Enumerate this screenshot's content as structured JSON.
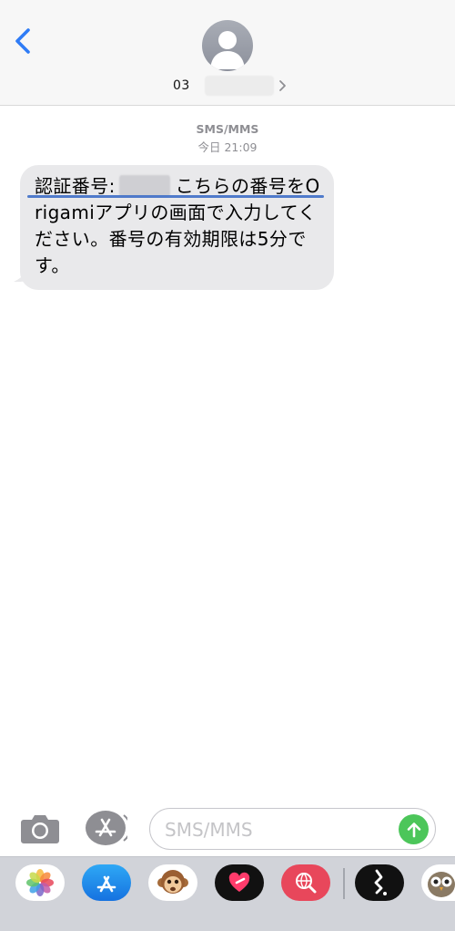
{
  "header": {
    "contact_prefix": "03",
    "back_icon": "chevron-left-icon",
    "avatar_icon": "person-silhouette-icon"
  },
  "messages": {
    "service_label": "SMS/MMS",
    "timestamp": "今日 21:09",
    "bubble": {
      "prefix": "認証番号:",
      "body": "こちらの番号をOrigamiアプリの画面で入力してください。番号の有効期限は5分です。"
    }
  },
  "compose": {
    "placeholder": "SMS/MMS",
    "camera_icon": "camera-icon",
    "apps_icon": "app-store-icon",
    "send_icon": "arrow-up-icon"
  },
  "drawer": {
    "apps": [
      {
        "name": "photos-app-icon"
      },
      {
        "name": "app-store-app-icon"
      },
      {
        "name": "animoji-app-icon"
      },
      {
        "name": "digital-touch-app-icon"
      },
      {
        "name": "web-search-app-icon"
      },
      {
        "name": "music-app-icon"
      },
      {
        "name": "owl-sticker-app-icon"
      }
    ]
  },
  "colors": {
    "ios_blue": "#2f7cf6",
    "bubble_gray": "#e9e9eb",
    "send_green": "#4cc65a",
    "meta_gray": "#8e8e93"
  }
}
